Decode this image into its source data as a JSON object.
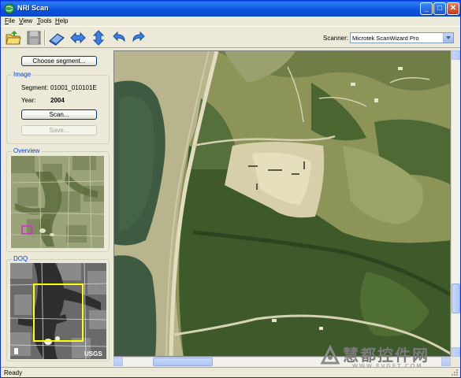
{
  "window": {
    "title": "NRI Scan",
    "min_glyph": "_",
    "max_glyph": "□",
    "close_glyph": "✕"
  },
  "menu": [
    "File",
    "View",
    "Tools",
    "Help"
  ],
  "toolbar": {
    "buttons": [
      "open-folder-icon",
      "save-disk-icon",
      "scan-icon",
      "horizontal-resize-icon",
      "vertical-resize-icon",
      "undo-icon",
      "redo-icon"
    ],
    "scanner_label": "Scanner:",
    "scanner_value": "Microtek ScanWizard Pro"
  },
  "left": {
    "choose_segment": "Choose segment...",
    "image_group": {
      "title": "Image",
      "segment_label": "Segment:",
      "segment_value": "01001_010101E",
      "year_label": "Year:",
      "year_value": "2004",
      "scan_button": "Scan...",
      "save_button": "Save..."
    },
    "overview_title": "Overview",
    "doq_title": "DOQ",
    "usgs_text": "USGS"
  },
  "status": {
    "text": "Ready"
  },
  "watermark": {
    "text": "慧都控件网",
    "url": "WWW.EVGET.COM"
  },
  "colors": {
    "title_bar": "#0a5be0",
    "group_title": "#0046d5",
    "overview_marker": "#cc33cc",
    "doq_marker": "#ffff00"
  }
}
